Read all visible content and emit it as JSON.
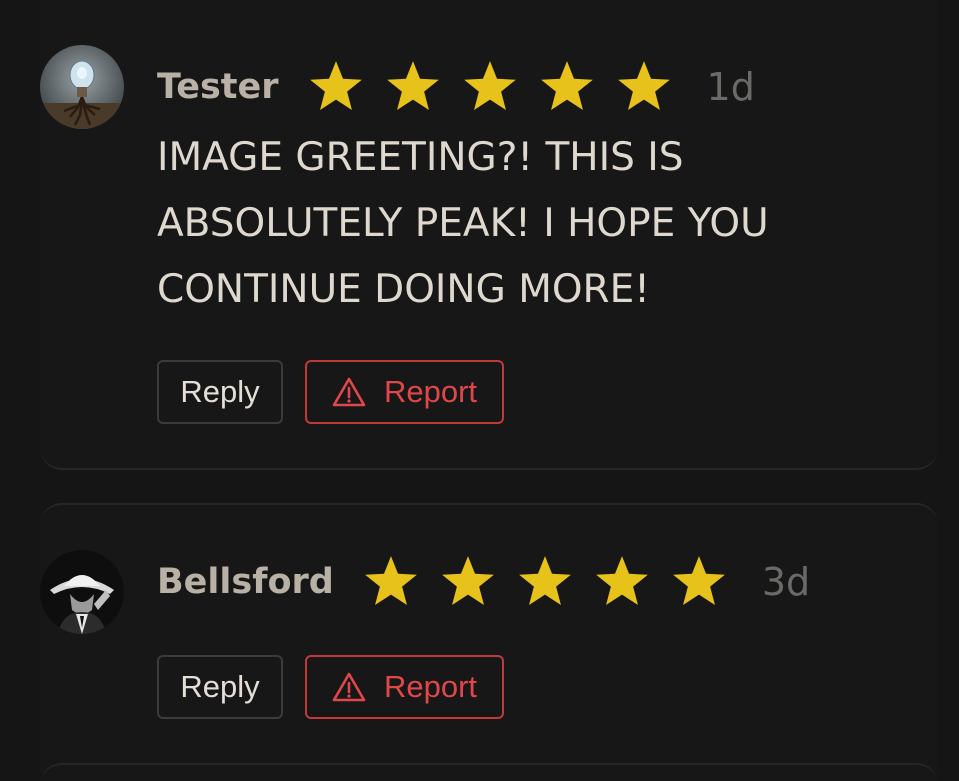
{
  "comments": [
    {
      "username": "Tester",
      "rating": 5,
      "max_rating": 5,
      "time": "1d",
      "text": "IMAGE GREETING?! THIS IS ABSOLUTELY PEAK! I HOPE YOU CONTINUE DOING MORE!",
      "avatar_icon": "lightbulb-tree-avatar",
      "reply_label": "Reply",
      "report_label": "Report"
    },
    {
      "username": "Bellsford",
      "rating": 5,
      "max_rating": 5,
      "time": "3d",
      "text": "",
      "avatar_icon": "hat-figure-avatar",
      "reply_label": "Reply",
      "report_label": "Report"
    }
  ],
  "colors": {
    "background": "#151515",
    "star": "#e7c21a",
    "username": "#b9b1a5",
    "text": "#ded8ce",
    "report": "#e0474a"
  }
}
